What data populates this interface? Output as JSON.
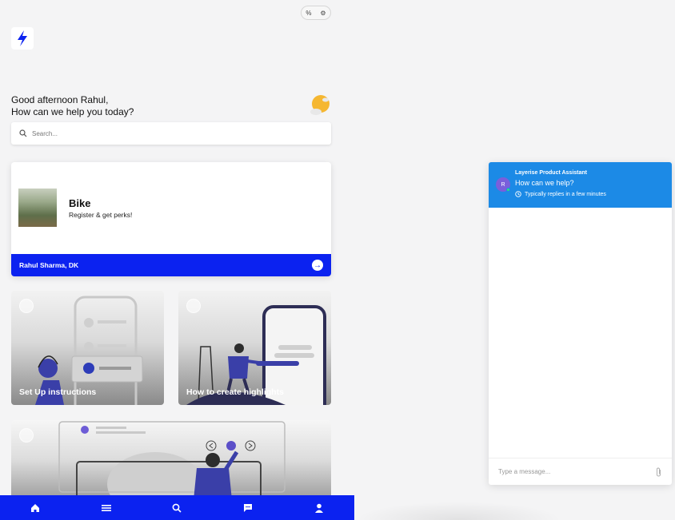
{
  "top_pill": {
    "left_glyph": "%",
    "right_glyph": "⚙"
  },
  "greeting": {
    "line1": "Good afternoon Rahul,",
    "line2": "How can we help you today?"
  },
  "search": {
    "placeholder": "Search..."
  },
  "product": {
    "title": "Bike",
    "subtitle": "Register & get perks!",
    "owner": "Rahul Sharma, DK"
  },
  "tiles": [
    {
      "title": "Set Up instructions"
    },
    {
      "title": "How to create highlights"
    }
  ],
  "bottom_nav": {
    "items": [
      "home-icon",
      "menu-icon",
      "search-icon",
      "chat-icon",
      "profile-icon"
    ],
    "color": "#0b22f0"
  },
  "chat": {
    "assistant_name": "Layerise Product Assistant",
    "avatar_initial": "R",
    "headline": "How can we help?",
    "reply_time": "Typically replies in a few minutes",
    "input_placeholder": "Type a message...",
    "header_color": "#1c8ae6"
  }
}
